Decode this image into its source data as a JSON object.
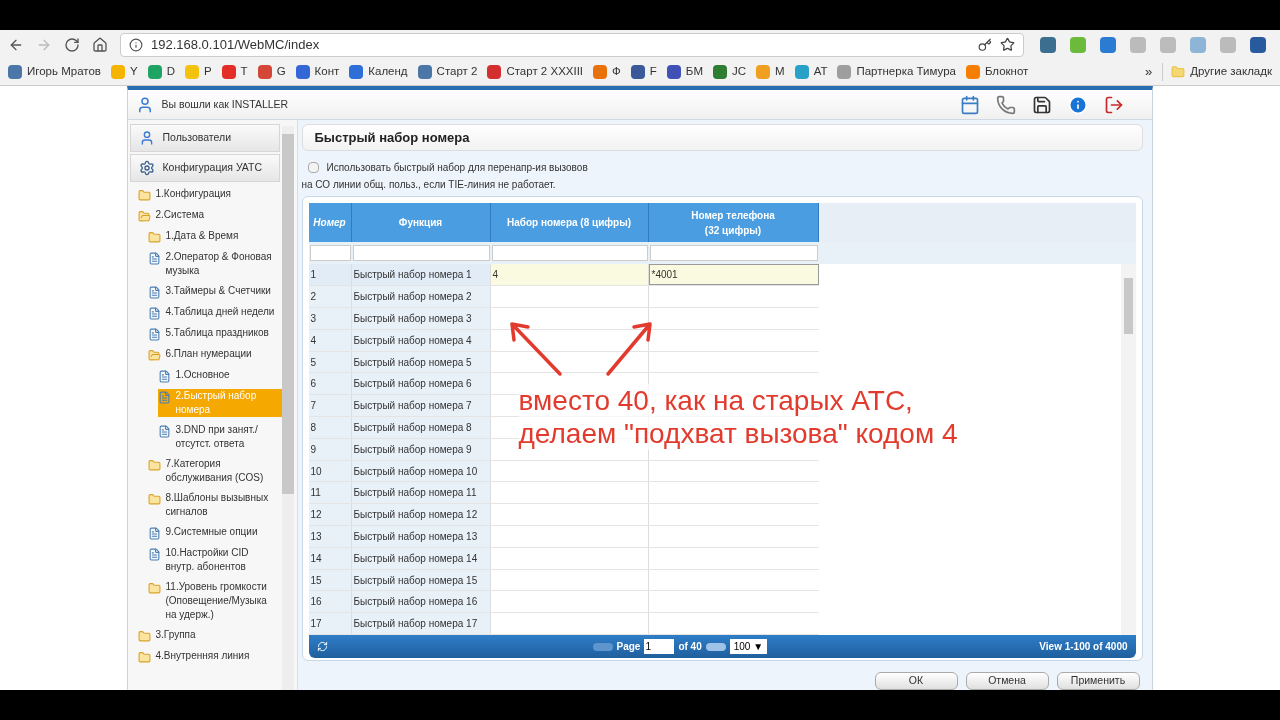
{
  "browser": {
    "url": "192.168.0.101/WebMC/index",
    "bookmarks": [
      {
        "label": "Игорь Мратов",
        "color": "#4a76a8"
      },
      {
        "label": "Y",
        "color": "#f5b400"
      },
      {
        "label": "D",
        "color": "#1fa463"
      },
      {
        "label": "P",
        "color": "#f4c20d"
      },
      {
        "label": "T",
        "color": "#e52d27"
      },
      {
        "label": "G",
        "color": "#d44638"
      },
      {
        "label": "Конт",
        "color": "#3367d6"
      },
      {
        "label": "Календ",
        "color": "#2d6fd6"
      },
      {
        "label": "Старт 2",
        "color": "#4a76a8"
      },
      {
        "label": "Старт 2 XXXIII",
        "color": "#d32f2f"
      },
      {
        "label": "Ф",
        "color": "#e8710a"
      },
      {
        "label": "F",
        "color": "#3b5998"
      },
      {
        "label": "БМ",
        "color": "#3f51b5"
      },
      {
        "label": "JC",
        "color": "#2e7d32"
      },
      {
        "label": "M",
        "color": "#f0a020"
      },
      {
        "label": "АТ",
        "color": "#29a0c8"
      },
      {
        "label": "Партнерка Тимура",
        "color": "#9e9e9e"
      },
      {
        "label": "Блокнот",
        "color": "#f57d00"
      }
    ],
    "more": "»",
    "other_bookmarks": "Другие закладк"
  },
  "app": {
    "user": "Вы вошли как INSTALLER",
    "sidebar": {
      "sections": [
        {
          "label": "Пользователи"
        },
        {
          "label": "Конфигурация УАТС"
        }
      ],
      "tree": [
        {
          "label": "1.Конфигурация",
          "kind": "folder",
          "expanded": false,
          "selected": false
        },
        {
          "label": "2.Система",
          "kind": "folder",
          "expanded": true,
          "selected": false,
          "children": [
            {
              "label": "1.Дата & Время",
              "kind": "folder",
              "expanded": false,
              "selected": false
            },
            {
              "label": "2.Оператор & Фоновая музыка",
              "kind": "page",
              "selected": false
            },
            {
              "label": "3.Таймеры & Счетчики",
              "kind": "page",
              "selected": false
            },
            {
              "label": "4.Таблица дней недели",
              "kind": "page",
              "selected": false
            },
            {
              "label": "5.Таблица праздников",
              "kind": "page",
              "selected": false
            },
            {
              "label": "6.План нумерации",
              "kind": "folder",
              "expanded": true,
              "selected": false,
              "children": [
                {
                  "label": "1.Основное",
                  "kind": "page",
                  "selected": false
                },
                {
                  "label": "2.Быстрый набор номера",
                  "kind": "page",
                  "selected": true
                },
                {
                  "label": "3.DND при занят./ отсутст. ответа",
                  "kind": "page",
                  "selected": false
                }
              ]
            },
            {
              "label": "7.Категория обслуживания (COS)",
              "kind": "folder",
              "expanded": false,
              "selected": false
            },
            {
              "label": "8.Шаблоны вызывных сигналов",
              "kind": "folder",
              "expanded": false,
              "selected": false
            },
            {
              "label": "9.Системные опции",
              "kind": "page",
              "selected": false
            },
            {
              "label": "10.Настройки CID внутр. абонентов",
              "kind": "page",
              "selected": false
            },
            {
              "label": "11.Уровень громкости (Оповещение/Музыка на удерж.)",
              "kind": "folder",
              "expanded": false,
              "selected": false
            }
          ]
        },
        {
          "label": "3.Группа",
          "kind": "folder",
          "expanded": false,
          "selected": false
        },
        {
          "label": "4.Внутренняя линия",
          "kind": "folder",
          "expanded": false,
          "selected": false
        }
      ]
    },
    "page_title": "Быстрый набор номера",
    "option": {
      "label": "Использовать быстрый набор для перенапр-ия вызовов",
      "note": "на СО линии общ. польз., если TIE-линия не работает.",
      "checked": false
    },
    "table": {
      "columns": [
        "Номер",
        "Функция",
        "Набор номера (8 цифры)",
        "Номер телефона (32 цифры)"
      ],
      "rows": [
        {
          "number": "1",
          "function": "Быстрый набор номера 1",
          "dial": "4",
          "phone": "*4001",
          "highlighted": true
        },
        {
          "number": "2",
          "function": "Быстрый набор номера 2",
          "highlighted": false
        },
        {
          "number": "3",
          "function": "Быстрый набор номера 3",
          "highlighted": false
        },
        {
          "number": "4",
          "function": "Быстрый набор номера 4",
          "highlighted": false
        },
        {
          "number": "5",
          "function": "Быстрый набор номера 5",
          "highlighted": false
        },
        {
          "number": "6",
          "function": "Быстрый набор номера 6",
          "highlighted": false
        },
        {
          "number": "7",
          "function": "Быстрый набор номера 7",
          "highlighted": false
        },
        {
          "number": "8",
          "function": "Быстрый набор номера 8",
          "highlighted": false
        },
        {
          "number": "9",
          "function": "Быстрый набор номера 9",
          "highlighted": false
        },
        {
          "number": "10",
          "function": "Быстрый набор номера 10",
          "highlighted": false
        },
        {
          "number": "11",
          "function": "Быстрый набор номера 11",
          "highlighted": false
        },
        {
          "number": "12",
          "function": "Быстрый набор номера 12",
          "highlighted": false
        },
        {
          "number": "13",
          "function": "Быстрый набор номера 13",
          "highlighted": false
        },
        {
          "number": "14",
          "function": "Быстрый набор номера 14",
          "highlighted": false
        },
        {
          "number": "15",
          "function": "Быстрый набор номера 15",
          "highlighted": false
        },
        {
          "number": "16",
          "function": "Быстрый набор номера 16",
          "highlighted": false
        },
        {
          "number": "17",
          "function": "Быстрый набор номера 17",
          "highlighted": false
        }
      ],
      "pager": {
        "page_label": "Page",
        "page": "1",
        "of": "of 40",
        "page_size": "100 ▼",
        "view": "View 1-100 of 4000"
      }
    },
    "buttons": [
      "ОК",
      "Отмена",
      "Применить"
    ]
  },
  "annotation": [
    "вместо 40, как на старых АТС,",
    "делаем \"подхват вызова\" кодом 4"
  ]
}
